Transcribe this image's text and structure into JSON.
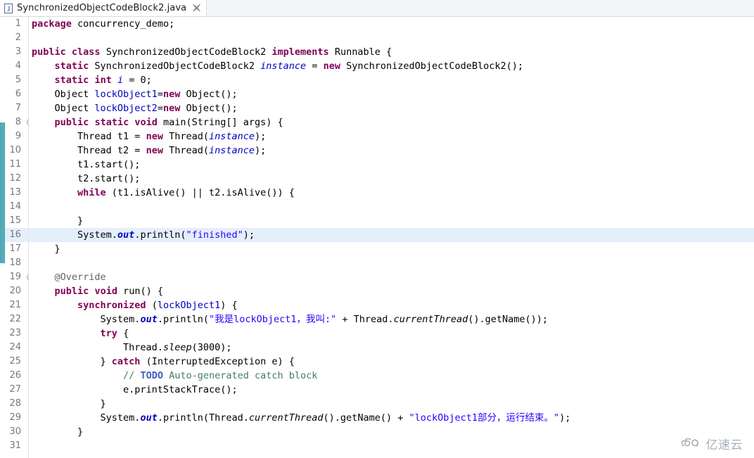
{
  "tab": {
    "label": "SynchronizedObjectCodeBlock2.java",
    "icon": "java-file-icon",
    "close_icon": "close-icon"
  },
  "editor": {
    "highlighted_line": 16,
    "first_line": 1,
    "last_line": 31,
    "colors": {
      "keyword": "#7f0055",
      "string": "#2a00ff",
      "field": "#0000c0",
      "comment": "#3f7f5f",
      "todo": "#3f5fbf",
      "annotation": "#646464",
      "current_line_highlight": "#e4effb",
      "gutter_text": "#777777",
      "annotation_stripe": "#2e97a8"
    },
    "markers": {
      "fold_lines": [
        8,
        19
      ],
      "override_line": 20,
      "todo_line": 26,
      "stripe_from_line": 8,
      "stripe_to_line": 17
    },
    "lines": [
      {
        "n": 1,
        "text": "package concurrency_demo;"
      },
      {
        "n": 2,
        "text": ""
      },
      {
        "n": 3,
        "text": "public class SynchronizedObjectCodeBlock2 implements Runnable {"
      },
      {
        "n": 4,
        "text": "    static SynchronizedObjectCodeBlock2 instance = new SynchronizedObjectCodeBlock2();"
      },
      {
        "n": 5,
        "text": "    static int i = 0;"
      },
      {
        "n": 6,
        "text": "    Object lockObject1=new Object();"
      },
      {
        "n": 7,
        "text": "    Object lockObject2=new Object();"
      },
      {
        "n": 8,
        "text": "    public static void main(String[] args) {"
      },
      {
        "n": 9,
        "text": "        Thread t1 = new Thread(instance);"
      },
      {
        "n": 10,
        "text": "        Thread t2 = new Thread(instance);"
      },
      {
        "n": 11,
        "text": "        t1.start();"
      },
      {
        "n": 12,
        "text": "        t2.start();"
      },
      {
        "n": 13,
        "text": "        while (t1.isAlive() || t2.isAlive()) {"
      },
      {
        "n": 14,
        "text": ""
      },
      {
        "n": 15,
        "text": "        }"
      },
      {
        "n": 16,
        "text": "        System.out.println(\"finished\");"
      },
      {
        "n": 17,
        "text": "    }"
      },
      {
        "n": 18,
        "text": ""
      },
      {
        "n": 19,
        "text": "    @Override"
      },
      {
        "n": 20,
        "text": "    public void run() {"
      },
      {
        "n": 21,
        "text": "        synchronized (lockObject1) {"
      },
      {
        "n": 22,
        "text": "            System.out.println(\"我是lockObject1，我叫:\" + Thread.currentThread().getName());"
      },
      {
        "n": 23,
        "text": "            try {"
      },
      {
        "n": 24,
        "text": "                Thread.sleep(3000);"
      },
      {
        "n": 25,
        "text": "            } catch (InterruptedException e) {"
      },
      {
        "n": 26,
        "text": "                // TODO Auto-generated catch block"
      },
      {
        "n": 27,
        "text": "                e.printStackTrace();"
      },
      {
        "n": 28,
        "text": "            }"
      },
      {
        "n": 29,
        "text": "            System.out.println(Thread.currentThread().getName() + \"lockObject1部分，运行结束。\");"
      },
      {
        "n": 30,
        "text": "        }"
      },
      {
        "n": 31,
        "text": ""
      }
    ]
  },
  "watermark": {
    "text": "亿速云",
    "icon": "cloud-icon"
  }
}
